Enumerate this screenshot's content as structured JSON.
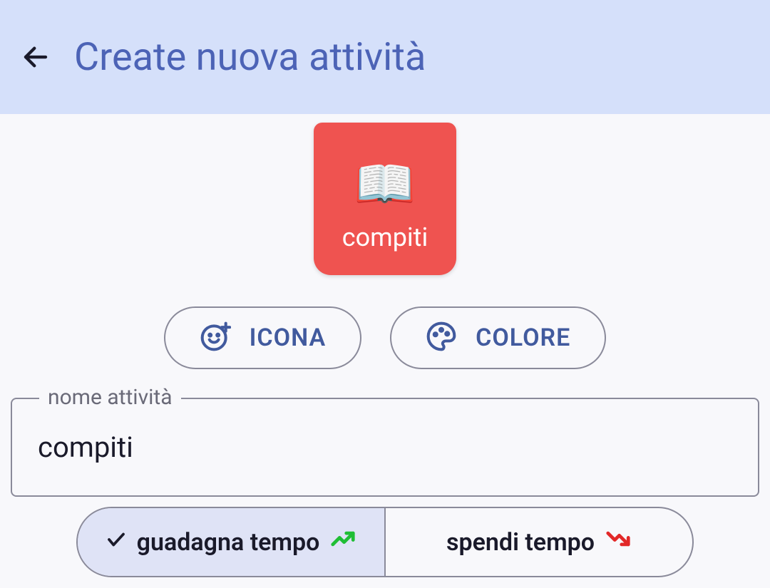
{
  "header": {
    "title": "Create nuova attività"
  },
  "activity": {
    "icon_name": "open-book",
    "card_label": "compiti",
    "card_color": "#ef5350"
  },
  "buttons": {
    "icon_label": "ICONA",
    "color_label": "COLORE"
  },
  "name_field": {
    "legend": "nome attività",
    "value": "compiti"
  },
  "toggle": {
    "gain_label": "guadagna tempo",
    "spend_label": "spendi tempo",
    "selected": "gain"
  }
}
